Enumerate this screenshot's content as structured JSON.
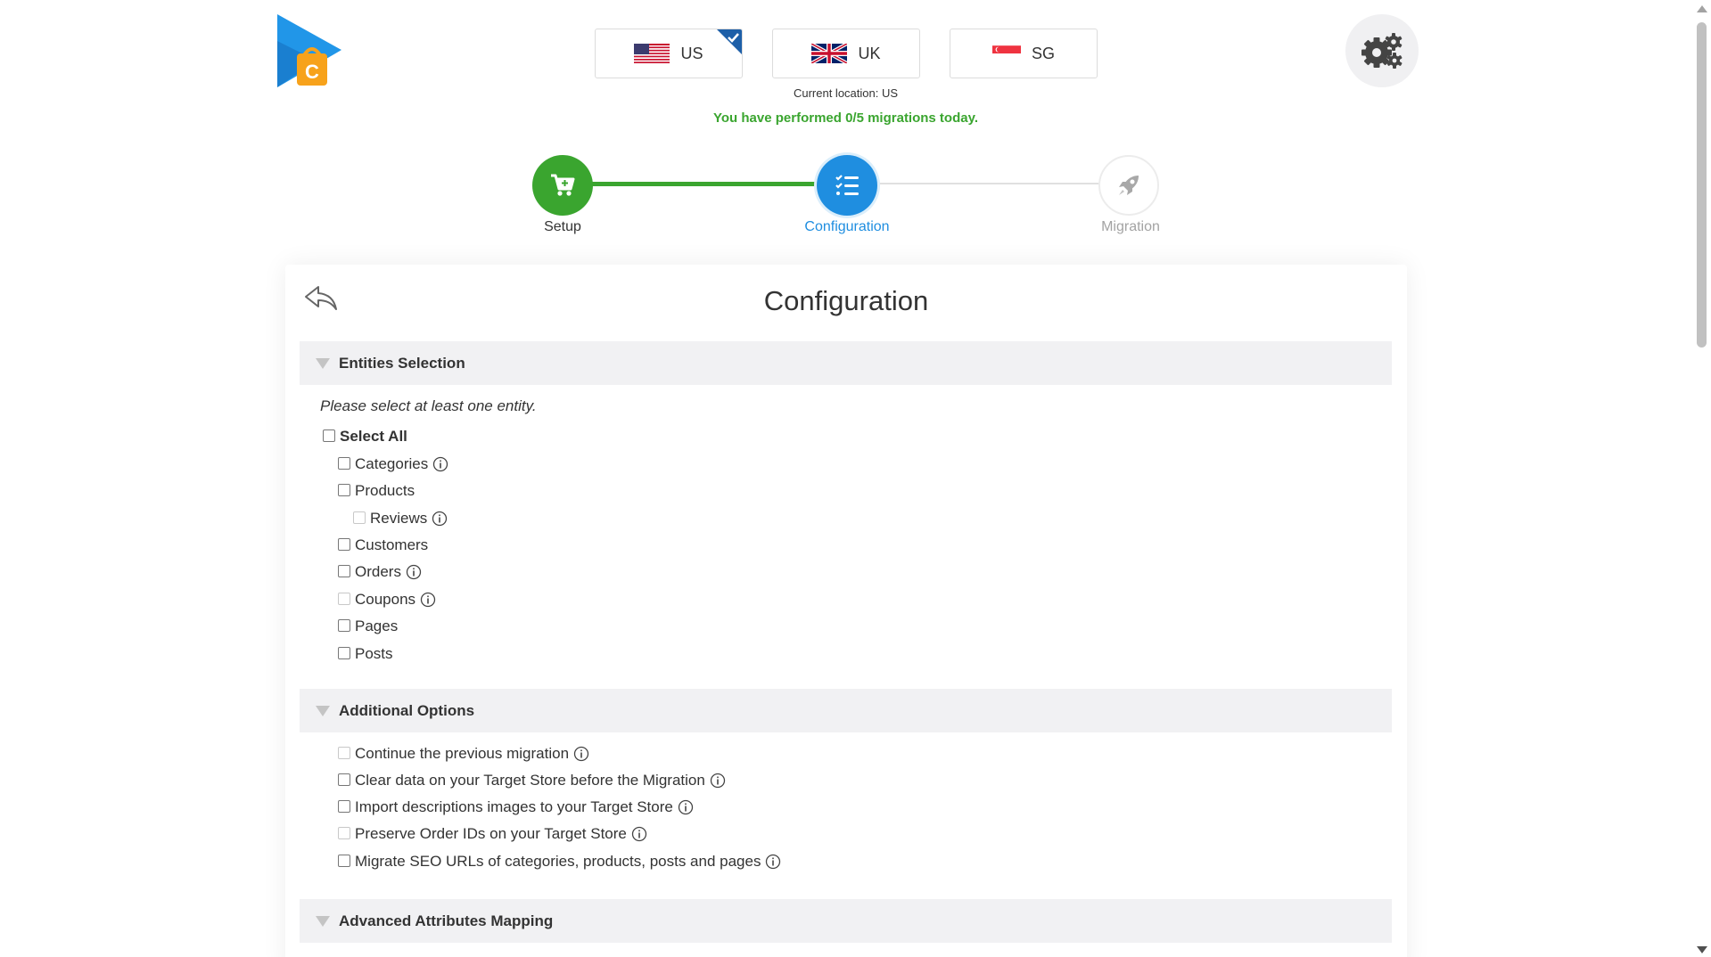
{
  "locations": [
    {
      "code": "US",
      "selected": true
    },
    {
      "code": "UK",
      "selected": false
    },
    {
      "code": "SG",
      "selected": false
    }
  ],
  "current_location": "Current location: US",
  "migration_count": "You have performed 0/5 migrations today.",
  "steps": [
    {
      "label": "Setup",
      "icon": "cart-icon",
      "state": "done"
    },
    {
      "label": "Configuration",
      "icon": "checklist-icon",
      "state": "active"
    },
    {
      "label": "Migration",
      "icon": "rocket-icon",
      "state": "pending"
    }
  ],
  "title": "Configuration",
  "sections": {
    "entities": {
      "heading": "Entities Selection",
      "hint": "Please select at least one entity.",
      "select_all": "Select All",
      "items": [
        {
          "label": "Categories",
          "info": true,
          "disabled": false
        },
        {
          "label": "Products",
          "info": false,
          "disabled": false
        },
        {
          "label": "Reviews",
          "info": true,
          "disabled": true
        },
        {
          "label": "Customers",
          "info": false,
          "disabled": false
        },
        {
          "label": "Orders",
          "info": true,
          "disabled": false
        },
        {
          "label": "Coupons",
          "info": true,
          "disabled": true
        },
        {
          "label": "Pages",
          "info": false,
          "disabled": false
        },
        {
          "label": "Posts",
          "info": false,
          "disabled": false
        }
      ]
    },
    "additional": {
      "heading": "Additional Options",
      "items": [
        {
          "label": "Continue the previous migration",
          "info": true,
          "disabled": true
        },
        {
          "label": "Clear data on your Target Store before the Migration",
          "info": true,
          "disabled": false
        },
        {
          "label": "Import descriptions images to your Target Store",
          "info": true,
          "disabled": false
        },
        {
          "label": "Preserve Order IDs on your Target Store",
          "info": true,
          "disabled": true
        },
        {
          "label": "Migrate SEO URLs of categories, products, posts and pages",
          "info": true,
          "disabled": false
        }
      ]
    },
    "advanced": {
      "heading": "Advanced Attributes Mapping"
    }
  },
  "colors": {
    "green": "#3aa52f",
    "blue": "#1f8ee0",
    "gray_step": "#b3b3b3"
  }
}
